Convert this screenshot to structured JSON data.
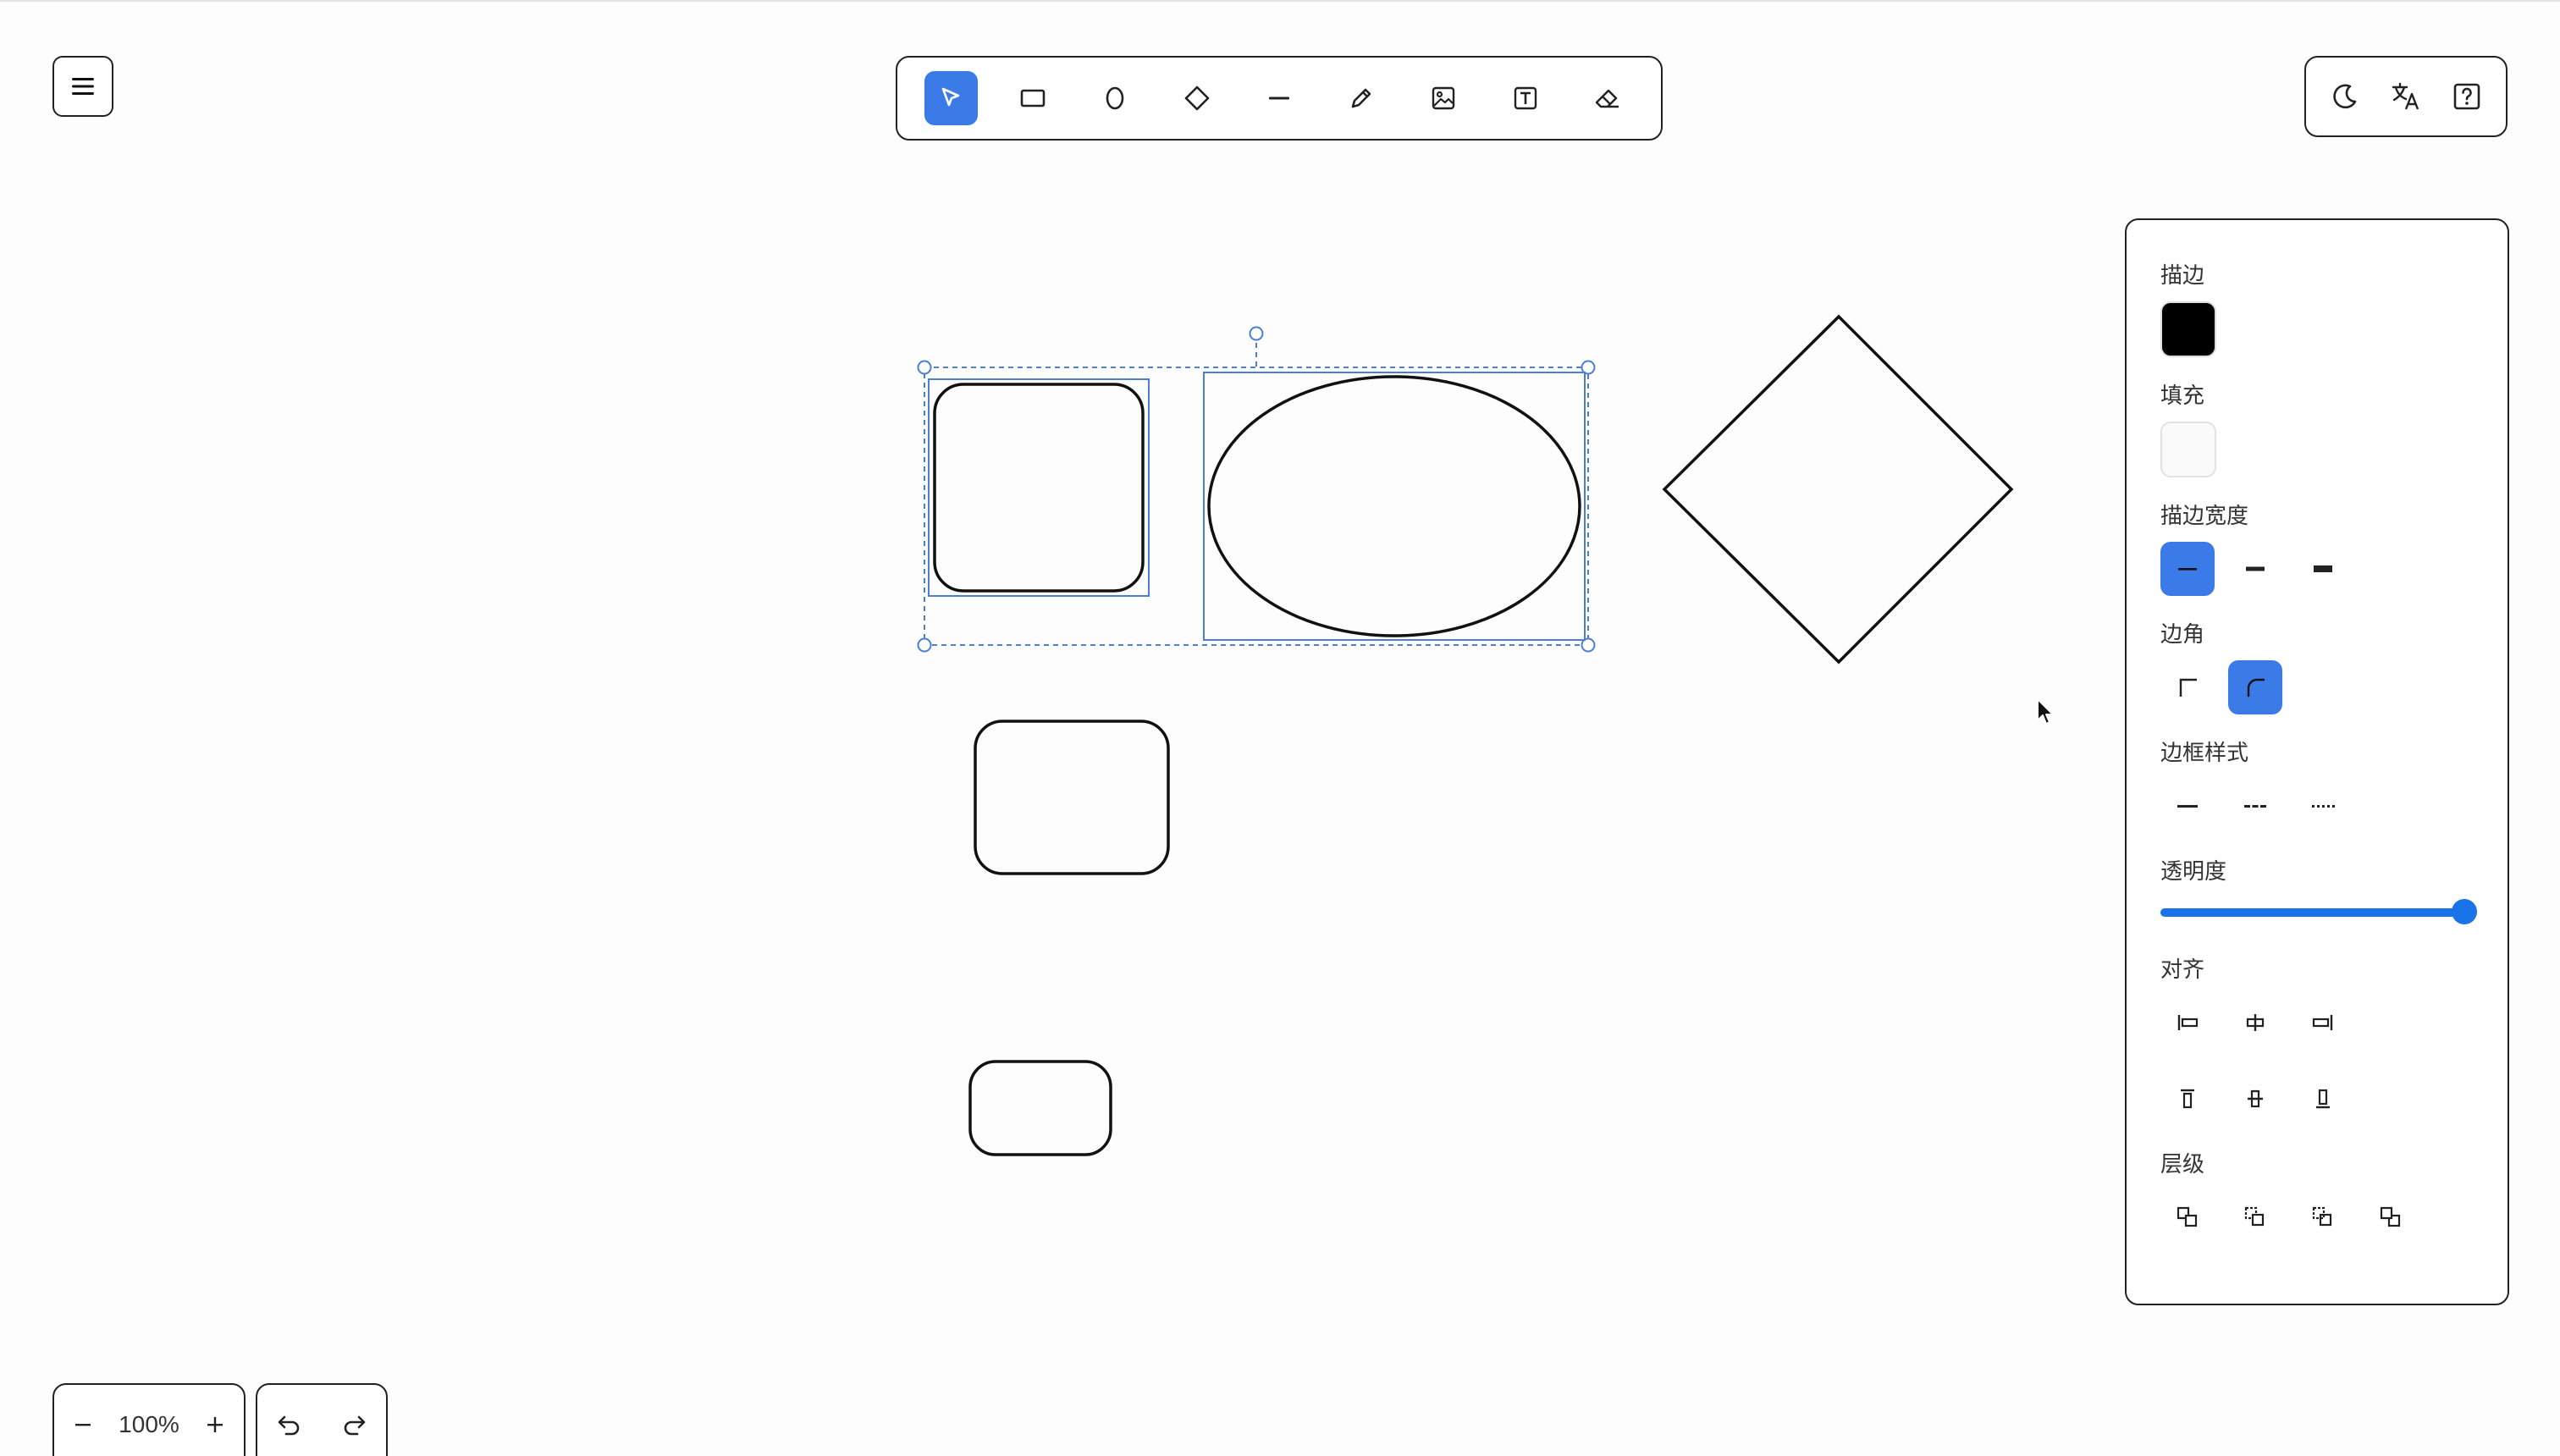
{
  "app": {
    "background": "#fdfdfd",
    "accent": "#3b7be8"
  },
  "menu": {
    "icon": "hamburger-icon"
  },
  "toolbar": {
    "tools": [
      {
        "name": "select",
        "icon": "pointer-icon",
        "active": true
      },
      {
        "name": "rectangle",
        "icon": "rectangle-icon"
      },
      {
        "name": "ellipse",
        "icon": "ellipse-icon"
      },
      {
        "name": "diamond",
        "icon": "diamond-icon"
      },
      {
        "name": "line",
        "icon": "line-icon"
      },
      {
        "name": "pencil",
        "icon": "pencil-icon"
      },
      {
        "name": "image",
        "icon": "image-icon"
      },
      {
        "name": "text",
        "icon": "text-icon"
      },
      {
        "name": "eraser",
        "icon": "eraser-icon"
      }
    ]
  },
  "topright": {
    "icons": [
      "moon-icon",
      "translate-icon",
      "help-icon"
    ]
  },
  "props": {
    "stroke_label": "描边",
    "stroke_color": "#000000",
    "fill_label": "填充",
    "fill_color": "#fafafa",
    "stroke_width_label": "描边宽度",
    "corner_label": "边角",
    "border_style_label": "边框样式",
    "opacity_label": "透明度",
    "opacity_value": 1.0,
    "align_label": "对齐",
    "layer_label": "层级"
  },
  "zoom": {
    "value": "100%",
    "minus": "−",
    "plus": "+"
  }
}
